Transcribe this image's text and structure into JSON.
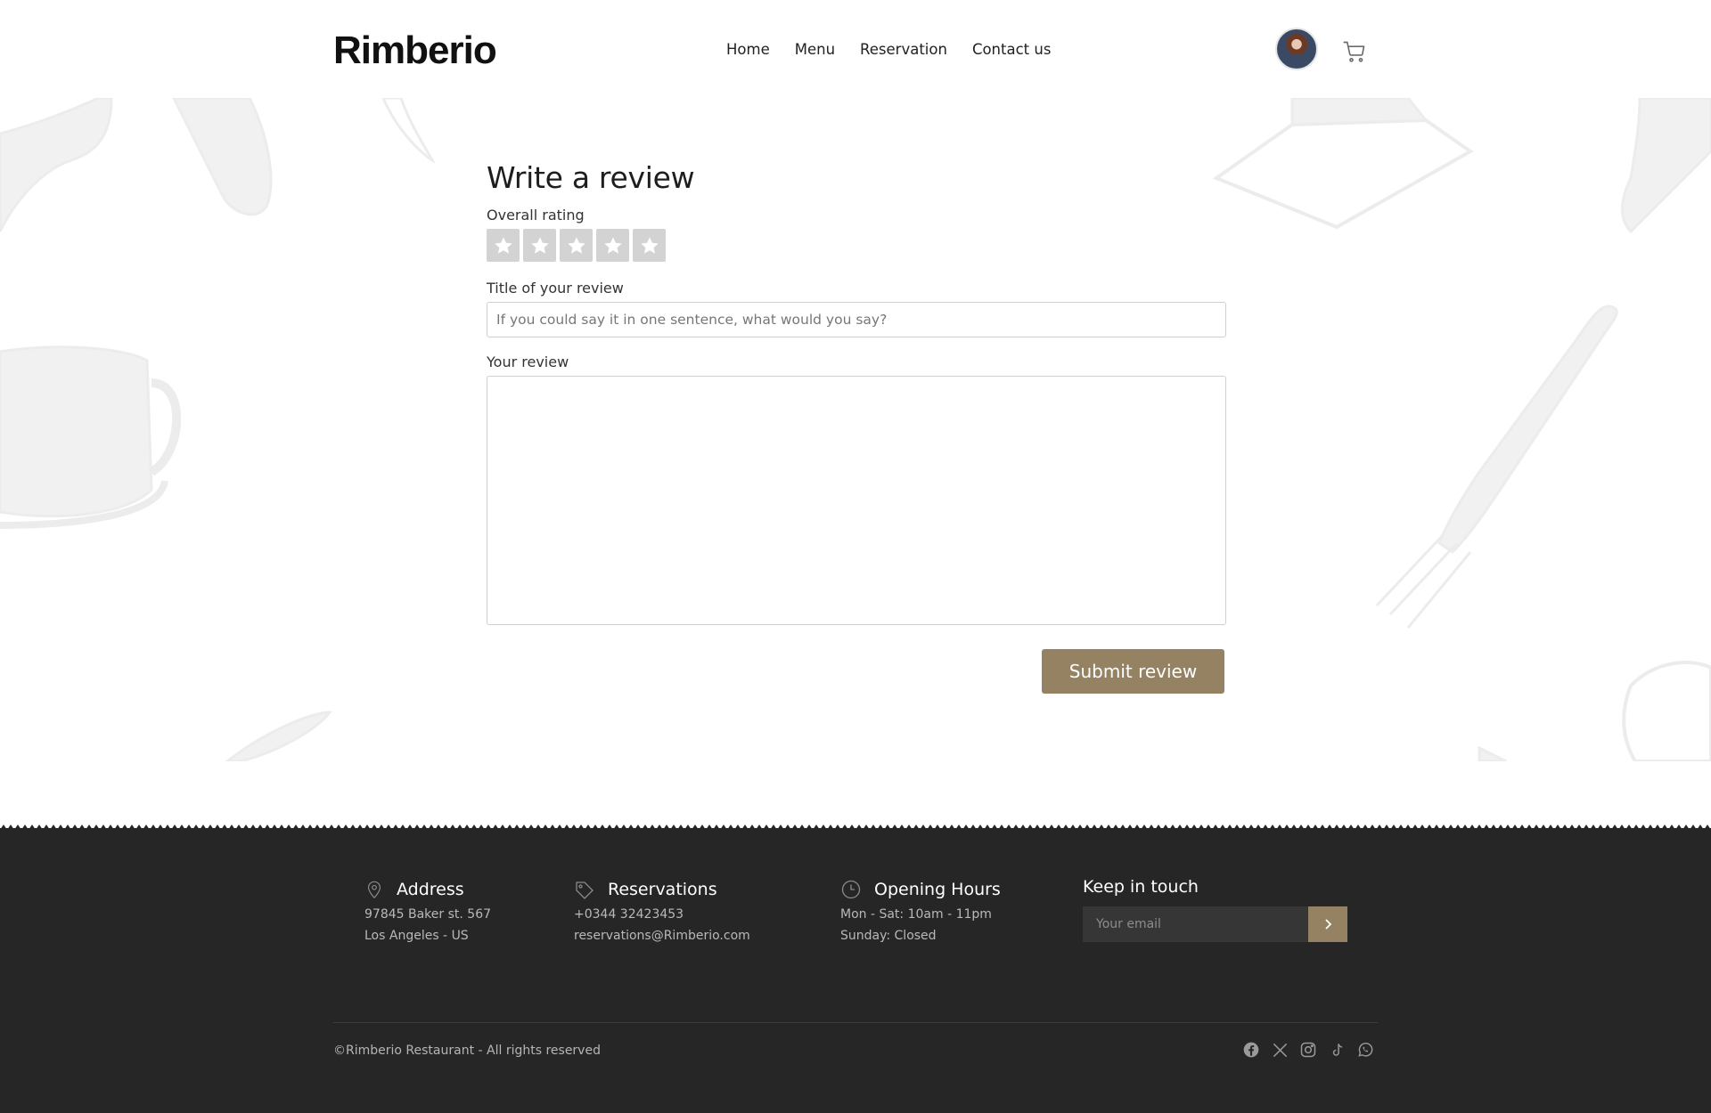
{
  "header": {
    "logo": "Rimberio",
    "nav": [
      "Home",
      "Menu",
      "Reservation",
      "Contact us"
    ]
  },
  "form": {
    "heading": "Write a review",
    "rating_label": "Overall rating",
    "rating_value": 0,
    "rating_max": 5,
    "title_label": "Title of your review",
    "title_placeholder": "If you could say it in one sentence, what would you say?",
    "review_label": "Your review",
    "review_value": "",
    "submit_label": "Submit review"
  },
  "footer": {
    "address": {
      "title": "Address",
      "lines": [
        "97845 Baker st. 567",
        "Los Angeles - US"
      ]
    },
    "reservations": {
      "title": "Reservations",
      "lines": [
        "+0344 32423453",
        "reservations@Rimberio.com"
      ]
    },
    "hours": {
      "title": "Opening Hours",
      "lines": [
        "Mon - Sat: 10am - 11pm",
        "Sunday: Closed"
      ]
    },
    "keep_in_touch": {
      "title": "Keep in touch",
      "email_placeholder": "Your email"
    },
    "copyright": "©Rimberio Restaurant - All rights reserved",
    "socials": [
      "facebook-icon",
      "x-icon",
      "instagram-icon",
      "tiktok-icon",
      "whatsapp-icon"
    ]
  },
  "colors": {
    "accent": "#948262",
    "footer_bg": "#262626",
    "star_bg": "#d3d3d3"
  }
}
